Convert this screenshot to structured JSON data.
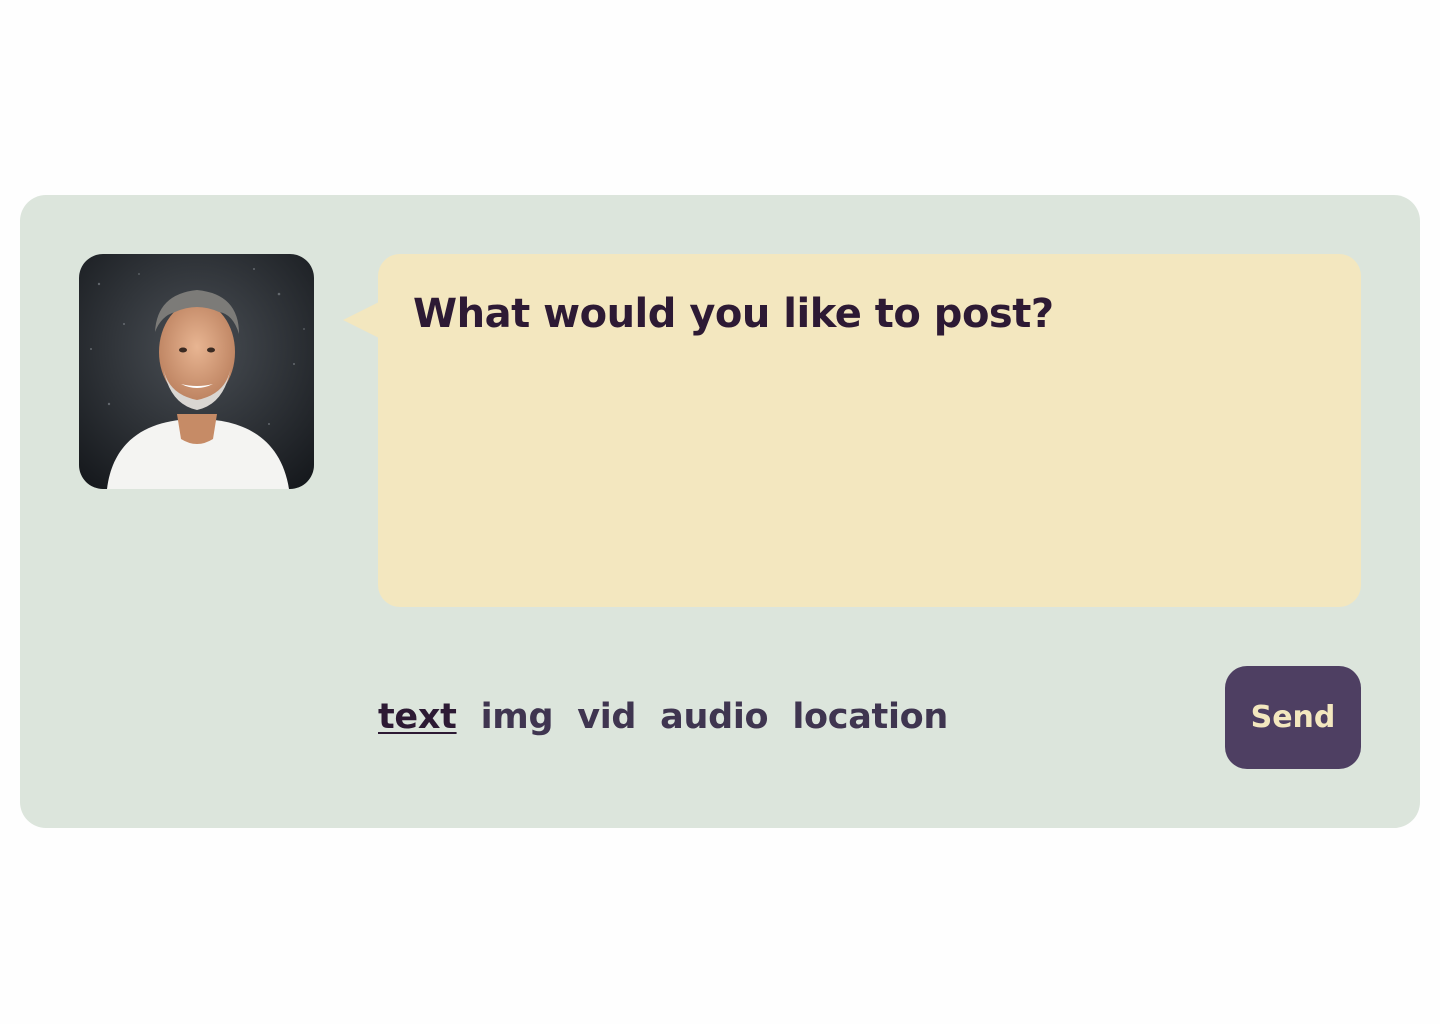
{
  "composer": {
    "prompt": "What would you like to post?",
    "input_value": "",
    "send_label": "Send",
    "tabs": [
      {
        "label": "text",
        "active": true
      },
      {
        "label": "img",
        "active": false
      },
      {
        "label": "vid",
        "active": false
      },
      {
        "label": "audio",
        "active": false
      },
      {
        "label": "location",
        "active": false
      }
    ]
  },
  "colors": {
    "card_background": "#dce5dc",
    "bubble_background": "#f3e7bf",
    "button_background": "#4e3f62",
    "button_text": "#f3e7bf",
    "text_primary": "#2d1a34",
    "tab_text": "#3f3550"
  },
  "icons": {
    "avatar": "user-avatar-photo"
  }
}
